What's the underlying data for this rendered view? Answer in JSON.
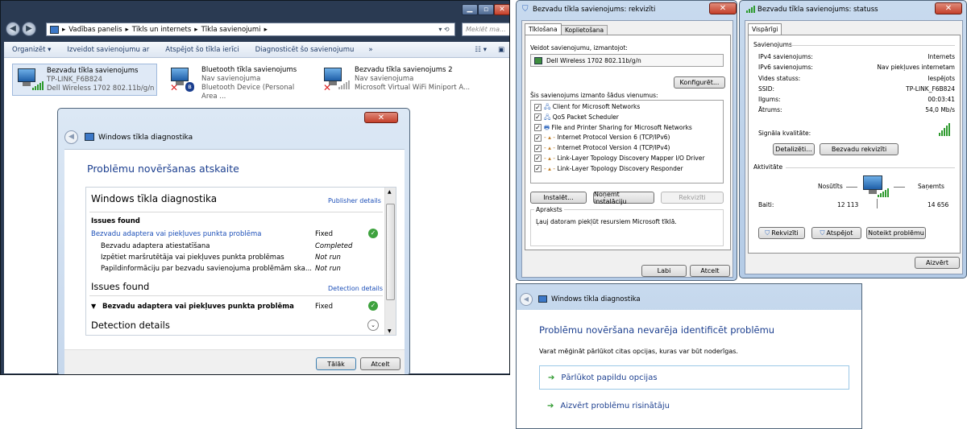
{
  "explorer": {
    "breadcrumb": [
      "Vadības panelis",
      "Tīkls un internets",
      "Tīkla savienojumi"
    ],
    "search_placeholder": "Meklēt ma...",
    "toolbar": [
      "Organizēt",
      "Izveidot savienojumu ar",
      "Atspējot šo tīkla ierīci",
      "Diagnosticēt šo savienojumu",
      "»"
    ],
    "connections": [
      {
        "name": "Bezvadu tīkla savienojums",
        "line2": "TP-LINK_F6B824",
        "line3": "Dell Wireless 1702 802.11b/g/n"
      },
      {
        "name": "Bluetooth tīkla savienojums",
        "line2": "Nav savienojuma",
        "line3": "Bluetooth Device (Personal Area ..."
      },
      {
        "name": "Bezvadu tīkla savienojums 2",
        "line2": "Nav savienojuma",
        "line3": "Microsoft Virtual WiFi Miniport A..."
      }
    ]
  },
  "diag1": {
    "title": "Windows tīkla diagnostika",
    "heading": "Problēmu novēršanas atskaite",
    "section_title": "Windows tīkla diagnostika",
    "publisher_link": "Publisher details",
    "issues_found": "Issues found",
    "issues": [
      {
        "text": "Bezvadu adaptera vai piekļuves punkta problēma",
        "status": "Fixed",
        "link": true
      },
      {
        "text": "Bezvadu adaptera atiestatīšana",
        "status": "Completed",
        "link": false
      },
      {
        "text": "Izpētiet maršrutētāja vai piekļuves punkta problēmas",
        "status": "Not run",
        "link": false
      },
      {
        "text": "Papildinformāciju par bezvadu savienojuma problēmām ska...",
        "status": "Not run",
        "link": false
      }
    ],
    "issues_found2": "Issues found",
    "detection_link": "Detection details",
    "detail_issue": "Bezvadu adaptera vai piekļuves punkta problēma",
    "detail_status": "Fixed",
    "detection_details": "Detection details",
    "next": "Tālāk",
    "cancel": "Atcelt"
  },
  "props": {
    "title": "Bezvadu tīkla savienojums: rekvizīti",
    "tabs": [
      "Tīklošana",
      "Koplietošana"
    ],
    "connect_using": "Veidot savienojumu, izmantojot:",
    "adapter": "Dell Wireless 1702 802.11b/g/n",
    "configure": "Konfigurēt...",
    "items_label": "Šis savienojums izmanto šādus vienumus:",
    "items": [
      "Client for Microsoft Networks",
      "QoS Packet Scheduler",
      "File and Printer Sharing for Microsoft Networks",
      "Internet Protocol Version 6 (TCP/IPv6)",
      "Internet Protocol Version 4 (TCP/IPv4)",
      "Link-Layer Topology Discovery Mapper I/O Driver",
      "Link-Layer Topology Discovery Responder"
    ],
    "install": "Instalēt...",
    "uninstall": "Noņemt instalāciju",
    "properties": "Rekvizīti",
    "desc_label": "Apraksts",
    "desc": "Ļauj datoram piekļūt resursiem Microsoft tīklā.",
    "ok": "Labi",
    "cancel": "Atcelt"
  },
  "status": {
    "title": "Bezvadu tīkla savienojums: statuss",
    "tab": "Vispārīgi",
    "group": "Savienojums",
    "rows": [
      {
        "k": "IPv4 savienojums:",
        "v": "Internets"
      },
      {
        "k": "IPv6 savienojums:",
        "v": "Nav piekļuves internetam"
      },
      {
        "k": "Vides statuss:",
        "v": "Iespējots"
      },
      {
        "k": "SSID:",
        "v": "TP-LINK_F6B824"
      },
      {
        "k": "Ilgums:",
        "v": "00:03:41"
      },
      {
        "k": "Ātrums:",
        "v": "54,0 Mb/s"
      }
    ],
    "signal": "Signāla kvalitāte:",
    "details": "Detalizēti...",
    "wireless_props": "Bezvadu rekvizīti",
    "activity": "Aktivitāte",
    "sent": "Nosūtīts",
    "received": "Saņemts",
    "bytes": "Baiti:",
    "sent_val": "12 113",
    "recv_val": "14 656",
    "properties": "Rekvizīti",
    "disable": "Atspējot",
    "diagnose": "Noteikt problēmu",
    "close": "Aizvērt"
  },
  "diag2": {
    "title": "Windows tīkla diagnostika",
    "heading": "Problēmu novēršana nevarēja identificēt problēmu",
    "sub": "Varat mēģināt pārlūkot citas opcijas, kuras var būt noderīgas.",
    "option1": "Pārlūkot papildu opcijas",
    "option2": "Aizvērt problēmu risinātāju"
  }
}
